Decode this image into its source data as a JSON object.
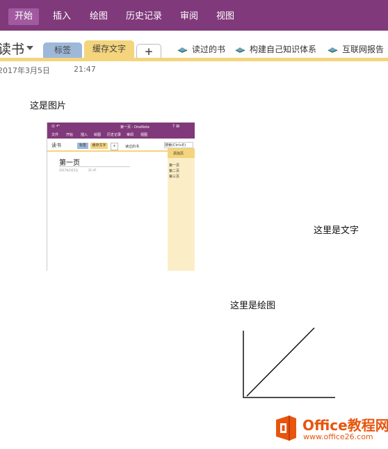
{
  "ribbon": {
    "tabs": [
      "开始",
      "插入",
      "绘图",
      "历史记录",
      "审阅",
      "视图"
    ],
    "active": "开始",
    "color": "#80397b"
  },
  "notebook": {
    "name": "读书",
    "sections": [
      {
        "label": "标签",
        "color": "#9db8d9"
      },
      {
        "label": "缓存文字",
        "color": "#f4d47c"
      }
    ],
    "add_label": "+",
    "links": [
      "读过的书",
      "构建自己知识体系",
      "互联网报告"
    ]
  },
  "page": {
    "date": "2017年3月5日",
    "time": "21:47",
    "image_caption": "这是图片",
    "text_note": "这里是文字",
    "drawing_caption": "这里是绘图"
  },
  "embedded_screenshot": {
    "title_bar": "第一页 - OneNote",
    "ribbon_tabs": [
      "文件",
      "开始",
      "插入",
      "绘图",
      "历史记录",
      "审阅",
      "视图"
    ],
    "notebook": "读书",
    "sections": [
      "标签",
      "缓存文字",
      "+"
    ],
    "link": "读过的书",
    "search": "搜索(Ctrl+E)",
    "add_page": "添加页",
    "pages": [
      "第一页",
      "第二页",
      "第三页"
    ],
    "page_title": "第一页",
    "date": "2017年3月5日",
    "time": "21:47"
  },
  "watermark": {
    "brand": "Office教程网",
    "url": "www.office26.com",
    "color": "#e8550f"
  }
}
